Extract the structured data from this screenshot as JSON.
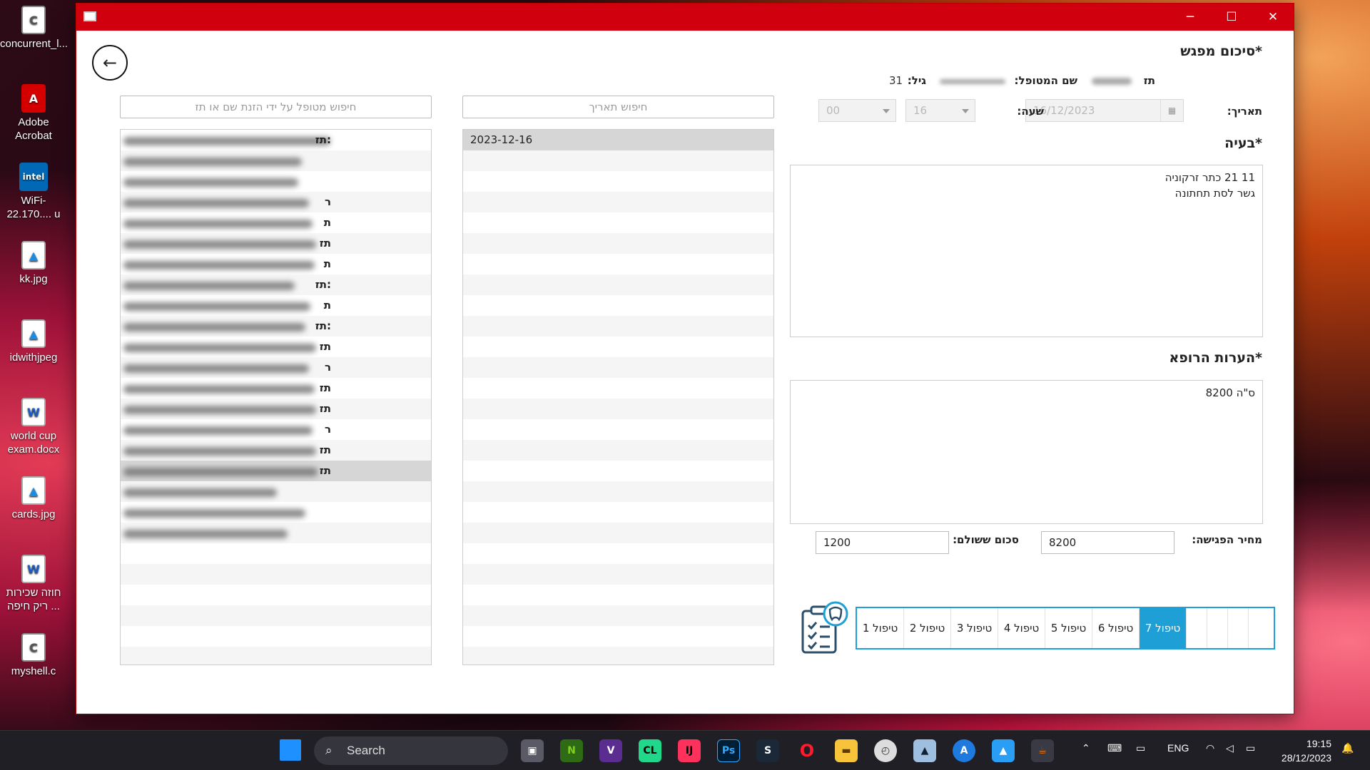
{
  "desktop": {
    "icons": [
      {
        "label": "concurrent_l...",
        "icon": "c-file-icon"
      },
      {
        "label": "Adobe\nAcrobat",
        "icon": "acrobat-icon"
      },
      {
        "label": "WiFi-22.170.... u",
        "icon": "intel-wifi-icon"
      },
      {
        "label": "kk.jpg",
        "icon": "image-file-icon"
      },
      {
        "label": "idwithjpeg",
        "icon": "image-file-icon"
      },
      {
        "label": "world cup\nexam.docx",
        "icon": "word-file-icon"
      },
      {
        "label": "cards.jpg",
        "icon": "image-file-icon"
      },
      {
        "label": "חוזה שכירות\nריק חיפה ...",
        "icon": "word-file-icon"
      },
      {
        "label": "myshell.c",
        "icon": "c-file-icon"
      }
    ]
  },
  "window": {
    "controls": {
      "minimize": "─",
      "maximize": "☐",
      "close": "✕"
    }
  },
  "form": {
    "title_summary": "*סיכום מפגש",
    "id_label": "תז",
    "patient_name_label": "שם המטופל:",
    "age_label": "גיל:",
    "age_value": "31",
    "date_label": "תאריך:",
    "date_value": "16/12/2023",
    "hour_label": "שעה:",
    "hour_value": "16",
    "minute_value": "00",
    "complaint_title": "*בעיה",
    "complaint_text": "11 21 כתר זרקוניה\nגשר לסת תחתונה",
    "doctor_notes_title": "*הערות הרופא",
    "doctor_notes_text": "ס\"ה 8200",
    "meeting_price_label": "מחיר הפגישה:",
    "meeting_price_value": "8200",
    "paid_label": "סכום ששולם:",
    "paid_value": "1200"
  },
  "search": {
    "patient_placeholder": "חיפוש מטופל על ידי הזנת שם או תז",
    "date_placeholder": "חיפוש תאריך"
  },
  "patients": {
    "rows": [
      {
        "id": "תז: ",
        "w": 290
      },
      {
        "id": "",
        "w": 250
      },
      {
        "id": "",
        "w": 245
      },
      {
        "id": "ר",
        "w": 260
      },
      {
        "id": "ת",
        "w": 265
      },
      {
        "id": "תז",
        "w": 270
      },
      {
        "id": "ת",
        "w": 268
      },
      {
        "id": "תז:",
        "w": 240
      },
      {
        "id": "ת",
        "w": 262
      },
      {
        "id": "תז: ",
        "w": 255
      },
      {
        "id": "תז",
        "w": 270
      },
      {
        "id": "ר",
        "w": 260
      },
      {
        "id": "תז",
        "w": 268
      },
      {
        "id": "תז",
        "w": 270
      },
      {
        "id": "ר",
        "w": 265
      },
      {
        "id": "תז",
        "w": 270
      },
      {
        "id": "תז",
        "w": 272
      },
      {
        "id": "",
        "w": 215
      },
      {
        "id": "",
        "w": 255
      },
      {
        "id": "",
        "w": 230
      }
    ],
    "selected_index": 16
  },
  "dates": {
    "items": [
      "2023-12-16"
    ]
  },
  "treatments": {
    "tabs": [
      "טיפול 1",
      "טיפול 2",
      "טיפול 3",
      "טיפול 4",
      "טיפול 5",
      "טיפול 6",
      "טיפול 7"
    ],
    "active_index": 6
  },
  "taskbar": {
    "search_label": "Search",
    "language": "ENG",
    "time": "19:15",
    "date": "28/12/2023"
  },
  "colors": {
    "titlebar": "#d1000f",
    "tab_active": "#1e9fd6"
  }
}
